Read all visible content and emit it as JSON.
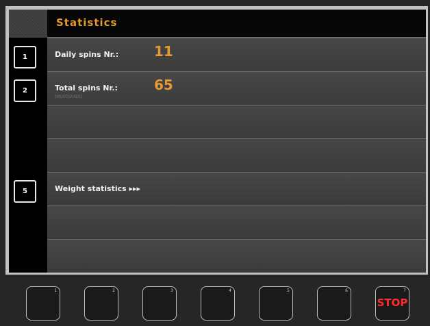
{
  "header": {
    "title": "Statistics"
  },
  "rows": [
    {
      "button": "1",
      "label": "Daily spins Nr.:",
      "value": "11",
      "sub": ""
    },
    {
      "button": "2",
      "label": "Total spins Nr.:",
      "value": "65",
      "sub": "[05/07/2015]"
    },
    {
      "button": "",
      "label": "",
      "value": "",
      "sub": ""
    },
    {
      "button": "",
      "label": "",
      "value": "",
      "sub": ""
    },
    {
      "button": "5",
      "label": "Weight statistics ▸▸▸",
      "value": "",
      "sub": ""
    },
    {
      "button": "",
      "label": "",
      "value": "",
      "sub": ""
    },
    {
      "button": "",
      "label": "",
      "value": "",
      "sub": ""
    }
  ],
  "function_keys": [
    {
      "number": "1",
      "label": ""
    },
    {
      "number": "2",
      "label": ""
    },
    {
      "number": "3",
      "label": ""
    },
    {
      "number": "4",
      "label": ""
    },
    {
      "number": "5",
      "label": ""
    },
    {
      "number": "6",
      "label": ""
    },
    {
      "number": "7",
      "label": "STOP"
    }
  ],
  "colors": {
    "accent": "#e39a32",
    "stop": "#ff2d2d"
  }
}
